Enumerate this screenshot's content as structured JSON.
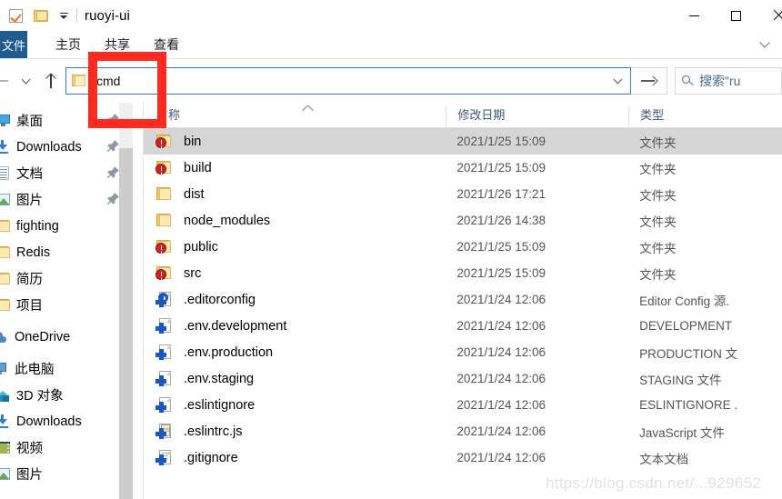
{
  "window": {
    "title": "ruoyi-ui",
    "quick_access": {
      "checkbox_icon": "checkbox-checked-icon",
      "folder_icon": "folder-icon",
      "customize_icon": "chevron-down-icon"
    },
    "controls": {
      "minimize": "minimize-icon",
      "maximize": "maximize-icon",
      "close": "close-icon"
    }
  },
  "ribbon": {
    "file_tab": "文件",
    "tabs": [
      {
        "label": "主页"
      },
      {
        "label": "共享"
      },
      {
        "label": "查看"
      }
    ],
    "expand_icon": "chevron-down-icon"
  },
  "navbar": {
    "back_icon": "arrow-left-icon",
    "forward_icon": "arrow-right-icon",
    "recent_icon": "chevron-down-icon",
    "up_icon": "arrow-up-icon",
    "address": {
      "value": "cmd",
      "folder_icon": "folder-icon",
      "dropdown_icon": "chevron-down-icon",
      "go_icon": "arrow-right-icon"
    },
    "search": {
      "icon": "search-icon",
      "placeholder": "搜索\"ru"
    }
  },
  "sidebar": {
    "quick_items": [
      {
        "label": "桌面",
        "icon": "desktop-icon",
        "pinned": true
      },
      {
        "label": "Downloads",
        "icon": "downloads-icon",
        "pinned": true
      },
      {
        "label": "文档",
        "icon": "documents-icon",
        "pinned": true
      },
      {
        "label": "图片",
        "icon": "pictures-icon",
        "pinned": true
      },
      {
        "label": "fighting",
        "icon": "folder-icon",
        "pinned": false
      },
      {
        "label": "Redis",
        "icon": "folder-icon",
        "pinned": false
      },
      {
        "label": "简历",
        "icon": "folder-icon",
        "pinned": false
      },
      {
        "label": "项目",
        "icon": "folder-icon",
        "pinned": false
      }
    ],
    "onedrive": {
      "label": "OneDrive",
      "icon": "cloud-icon"
    },
    "this_pc": {
      "label": "此电脑",
      "icon": "computer-icon"
    },
    "pc_items": [
      {
        "label": "3D 对象",
        "icon": "3d-objects-icon"
      },
      {
        "label": "Downloads",
        "icon": "downloads-icon"
      },
      {
        "label": "视频",
        "icon": "videos-icon"
      },
      {
        "label": "图片",
        "icon": "pictures-icon"
      }
    ]
  },
  "file_list": {
    "columns": [
      {
        "label": "名称",
        "sort": "asc"
      },
      {
        "label": "修改日期"
      },
      {
        "label": "类型"
      }
    ],
    "rows": [
      {
        "name": "bin",
        "date": "2021/1/25 15:09",
        "type": "文件夹",
        "icon": "folder-vc-red-icon",
        "selected": true
      },
      {
        "name": "build",
        "date": "2021/1/25 15:09",
        "type": "文件夹",
        "icon": "folder-vc-red-icon",
        "selected": false
      },
      {
        "name": "dist",
        "date": "2021/1/26 17:21",
        "type": "文件夹",
        "icon": "folder-icon",
        "selected": false
      },
      {
        "name": "node_modules",
        "date": "2021/1/26 14:38",
        "type": "文件夹",
        "icon": "folder-icon",
        "selected": false
      },
      {
        "name": "public",
        "date": "2021/1/25 15:09",
        "type": "文件夹",
        "icon": "folder-vc-red-icon",
        "selected": false
      },
      {
        "name": "src",
        "date": "2021/1/25 15:09",
        "type": "文件夹",
        "icon": "folder-vc-red-icon",
        "selected": false
      },
      {
        "name": ".editorconfig",
        "date": "2021/1/24 12:06",
        "type": "Editor Config 源.",
        "icon": "file-config-vc-icon",
        "selected": false
      },
      {
        "name": ".env.development",
        "date": "2021/1/24 12:06",
        "type": "DEVELOPMENT",
        "icon": "file-vc-plus-icon",
        "selected": false
      },
      {
        "name": ".env.production",
        "date": "2021/1/24 12:06",
        "type": "PRODUCTION 文",
        "icon": "file-vc-plus-icon",
        "selected": false
      },
      {
        "name": ".env.staging",
        "date": "2021/1/24 12:06",
        "type": "STAGING 文件",
        "icon": "file-vc-plus-icon",
        "selected": false
      },
      {
        "name": ".eslintignore",
        "date": "2021/1/24 12:06",
        "type": "ESLINTIGNORE .",
        "icon": "file-vc-plus-icon",
        "selected": false
      },
      {
        "name": ".eslintrc.js",
        "date": "2021/1/24 12:06",
        "type": "JavaScript 文件",
        "icon": "file-js-vc-icon",
        "selected": false
      },
      {
        "name": ".gitignore",
        "date": "2021/1/24 12:06",
        "type": "文本文档",
        "icon": "file-text-vc-icon",
        "selected": false
      }
    ]
  },
  "annotation": {
    "highlight_color": "#ff2b21",
    "target": "cmd"
  },
  "watermark": {
    "text": "https://blog.csdn.net/...929652"
  }
}
